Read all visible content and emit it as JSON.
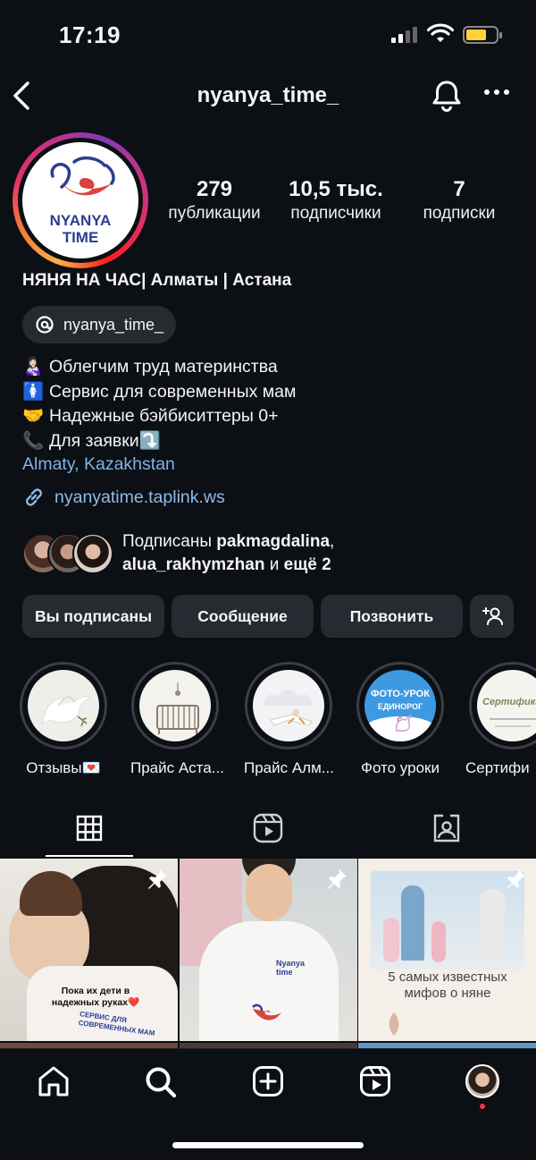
{
  "status_bar": {
    "time": "17:19"
  },
  "header": {
    "username": "nyanya_time_"
  },
  "profile": {
    "logo_line1": "NYANYA",
    "logo_line2": "TIME",
    "stats": [
      {
        "value": "279",
        "label": "публикации"
      },
      {
        "value": "10,5 тыс.",
        "label": "подписчики"
      },
      {
        "value": "7",
        "label": "подписки"
      }
    ],
    "display_name": "НЯНЯ НА ЧАС| Алматы | Астана",
    "threads_handle": "nyanya_time_",
    "bio": [
      {
        "emoji": "👩🏻‍🍼",
        "text": "Облегчим труд материнства"
      },
      {
        "emoji": "🚺",
        "text": "Сервис для современных мам"
      },
      {
        "emoji": "🤝",
        "text": "Надежные бэйбиситтеры 0+"
      },
      {
        "emoji": "📞",
        "text": "Для заявки⤵️"
      }
    ],
    "location": "Almaty, Kazakhstan",
    "link": "nyanyatime.taplink.ws",
    "followed_by_prefix": "Подписаны ",
    "followed_by_user1": "pakmagdalina",
    "followed_by_sep": ",",
    "followed_by_user2": "alua_rakhymzhan",
    "followed_by_mid": " и ",
    "followed_by_more": "ещё 2"
  },
  "actions": {
    "following": "Вы подписаны",
    "message": "Сообщение",
    "call": "Позвонить"
  },
  "highlights": [
    {
      "label": "Отзывы💌"
    },
    {
      "label": "Прайс Аста..."
    },
    {
      "label": "Прайс Алм..."
    },
    {
      "label": "Фото уроки",
      "cover_text_1": "ФОТО-УРОК",
      "cover_text_2": "ЕДИНОРОГ"
    },
    {
      "label": "Сертифи",
      "cover_text": "Сертификат"
    }
  ],
  "posts": [
    {
      "caption_1": "Пока их дети в",
      "caption_2": "надежных руках❤️",
      "shirt_text": "СЕРВИС ДЛЯ СОВРЕМЕННЫХ МАМ",
      "pinned": true
    },
    {
      "shirt_text": "Nyanya time",
      "pinned": true
    },
    {
      "caption": "5 самых известных мифов о няне",
      "pinned": true
    }
  ],
  "colors": {
    "link": "#8fbbe8",
    "background": "#0c0f14",
    "button": "#262a31"
  }
}
